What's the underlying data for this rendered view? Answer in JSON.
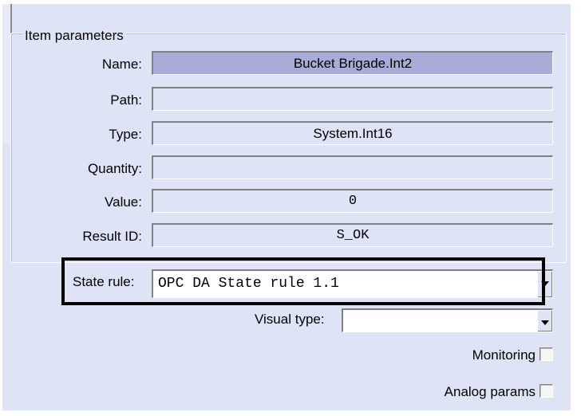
{
  "group": {
    "title": "Item parameters"
  },
  "fields": [
    {
      "label": "Name:",
      "value": "Bucket Brigade.Int2",
      "selected": true
    },
    {
      "label": "Path:",
      "value": ""
    },
    {
      "label": "Type:",
      "value": "System.Int16"
    },
    {
      "label": "Quantity:",
      "value": ""
    },
    {
      "label": "Value:",
      "value": "0"
    },
    {
      "label": "Result ID:",
      "value": "S_OK"
    }
  ],
  "state_rule": {
    "label": "State rule:",
    "value": "OPC DA State rule 1.1"
  },
  "visual_type": {
    "label": "Visual type:",
    "value": ""
  },
  "monitoring": {
    "label": "Monitoring",
    "checked": false
  },
  "analog_params": {
    "label": "Analog params",
    "checked": false
  },
  "colors": {
    "panel": "#dfe3f6",
    "selected_field": "#a9acd8",
    "highlight": "#000000"
  },
  "icons": {
    "dropdown": "chevron-down-icon"
  }
}
